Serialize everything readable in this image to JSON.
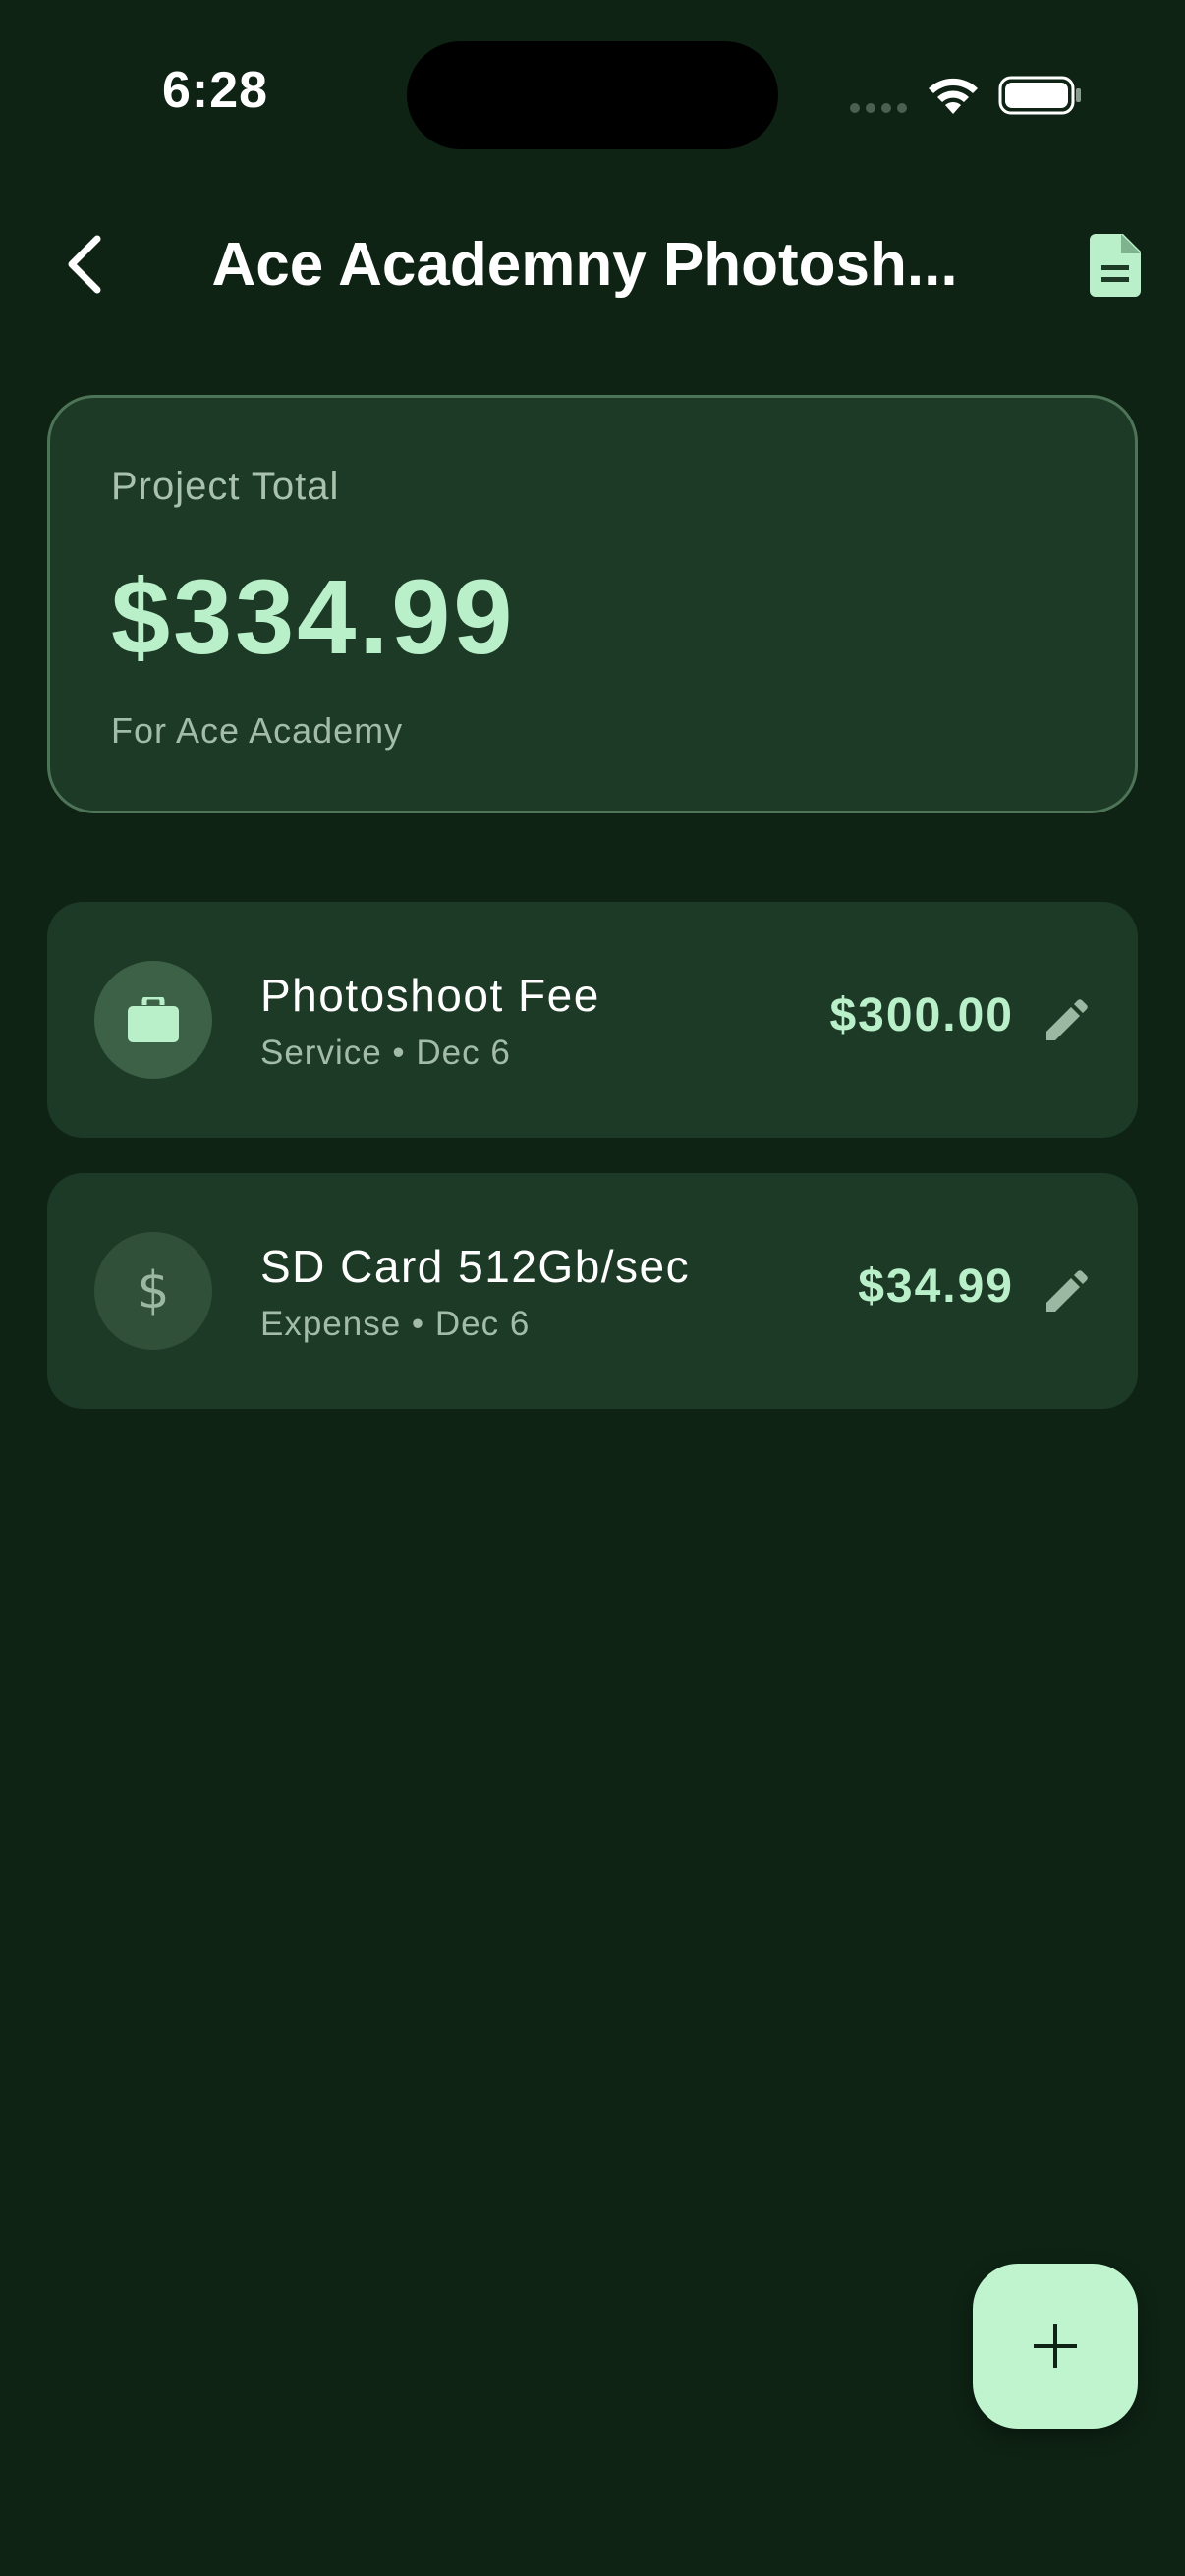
{
  "status_bar": {
    "time": "6:28"
  },
  "header": {
    "title": "Ace Academny Photosh...",
    "back_icon": "chevron-left-icon",
    "action_icon": "document-icon"
  },
  "summary": {
    "label": "Project Total",
    "amount": "$334.99",
    "client_line": "For Ace Academy"
  },
  "items": [
    {
      "title": "Photoshoot Fee",
      "subtitle": "Service • Dec 6",
      "amount": "$300.00",
      "icon": "briefcase-icon"
    },
    {
      "title": "SD Card 512Gb/sec",
      "subtitle": "Expense • Dec 6",
      "amount": "$34.99",
      "icon": "dollar-icon",
      "glyph": "$"
    }
  ],
  "fab": {
    "icon": "plus-icon"
  },
  "colors": {
    "background": "#0e2314",
    "card": "#1d3a26",
    "accent": "#b9f0c9",
    "fab": "#bff4cf"
  }
}
